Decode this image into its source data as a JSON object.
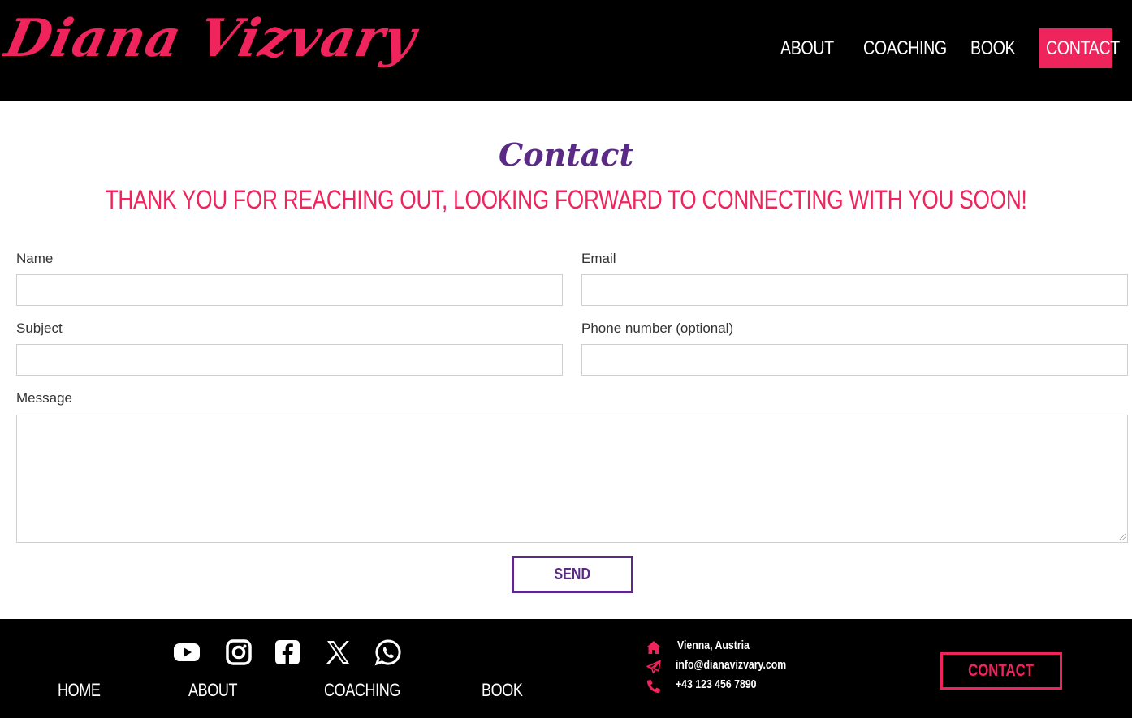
{
  "header": {
    "logo_text": "Diana Vizvary",
    "nav": {
      "about": "ABOUT",
      "coaching": "COACHING",
      "book": "BOOK",
      "contact": "CONTACT"
    }
  },
  "main": {
    "title": "Contact",
    "subtitle": "THANK YOU FOR REACHING OUT, LOOKING FORWARD TO CONNECTING WITH YOU SOON!",
    "form": {
      "name_label": "Name",
      "name_value": "",
      "email_label": "Email",
      "email_value": "",
      "subject_label": "Subject",
      "subject_value": "",
      "phone_label": "Phone number (optional)",
      "phone_value": "",
      "message_label": "Message",
      "message_value": "",
      "send_label": "SEND"
    }
  },
  "footer": {
    "social_icons": [
      "youtube-icon",
      "instagram-icon",
      "facebook-icon",
      "x-icon",
      "whatsapp-icon"
    ],
    "links": {
      "home": "HOME",
      "about": "ABOUT",
      "coaching": "COACHING",
      "book": "BOOK"
    },
    "info": {
      "location": "Vienna, Austria",
      "email": "info@dianavizvary.com",
      "phone": "+43 123 456 7890"
    },
    "contact_button": "CONTACT"
  },
  "colors": {
    "accent_pink": "#f0245c",
    "accent_purple": "#5b2a86",
    "header_bg": "#000000"
  }
}
